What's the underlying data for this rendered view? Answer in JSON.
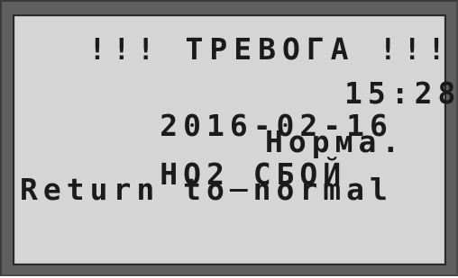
{
  "display": {
    "alarm_title": "!!! ТРЕВОГА !!!",
    "date": "2016-02-16",
    "time": "15:28",
    "event_code": "НО2_СБОЙ",
    "event_state": "Норма.",
    "message": "Return to normal"
  },
  "colors": {
    "bezel": "#5f5f5f",
    "screen_background": "#d5d5d5",
    "text": "#1b1b1b"
  }
}
